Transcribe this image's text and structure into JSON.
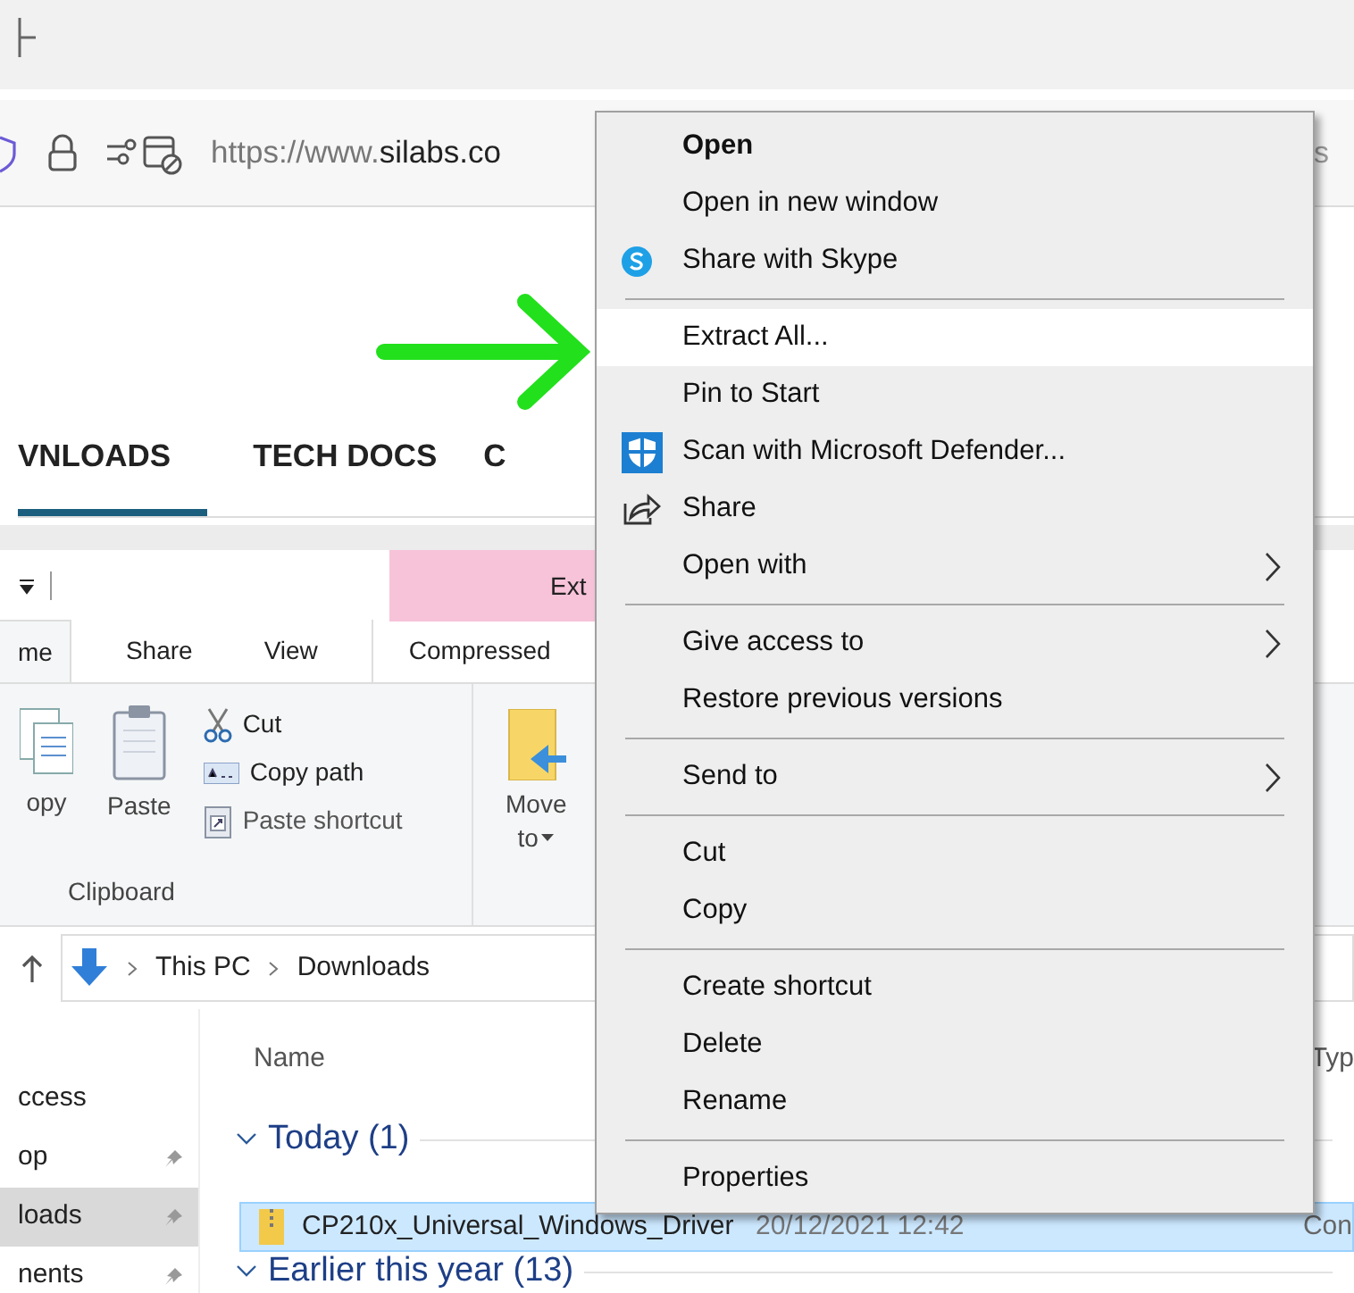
{
  "browser": {
    "address": {
      "url_prefix": "https://www.",
      "url_domain": "silabs.co",
      "url_tail": "s"
    },
    "nav_tabs": [
      {
        "label": "VNLOADS",
        "selected": true
      },
      {
        "label": "TECH DOCS",
        "selected": false
      },
      {
        "label": "C",
        "selected": false
      }
    ]
  },
  "explorer": {
    "contextual_tab": "Ext",
    "ribbon_tabs": [
      {
        "label": "me",
        "selected": true
      },
      {
        "label": "Share",
        "selected": false
      },
      {
        "label": "View",
        "selected": false
      },
      {
        "label": "Compressed",
        "selected": false
      }
    ],
    "clipboard": {
      "copy": "opy",
      "paste": "Paste",
      "cut": "Cut",
      "copy_path": "Copy path",
      "paste_shortcut": "Paste shortcut",
      "group_label": "Clipboard"
    },
    "move_to": {
      "line1": "Move",
      "line2": "to"
    },
    "breadcrumb": [
      "This PC",
      "Downloads"
    ],
    "nav_pane": [
      {
        "label": "ccess",
        "selected": false,
        "pinned": false
      },
      {
        "label": "op",
        "selected": false,
        "pinned": true
      },
      {
        "label": "loads",
        "selected": true,
        "pinned": true
      },
      {
        "label": "nents",
        "selected": false,
        "pinned": true
      }
    ],
    "columns": [
      "Name",
      "Typ"
    ],
    "groups": [
      {
        "label": "Today (1)",
        "expanded": true,
        "files": [
          {
            "name": "CP210x_Universal_Windows_Driver",
            "date": "20/12/2021 12:42",
            "type": "Con",
            "selected": true
          }
        ]
      },
      {
        "label": "Earlier this year (13)",
        "expanded": true
      }
    ]
  },
  "context_menu": [
    {
      "kind": "plain",
      "label": "Open",
      "default": true,
      "selected": false,
      "submenu": false
    },
    {
      "kind": "plain",
      "label": "Open in new window",
      "default": false,
      "selected": false,
      "submenu": false
    },
    {
      "kind": "skype",
      "label": "Share with Skype",
      "default": false,
      "selected": false,
      "submenu": false
    },
    {
      "kind": "separator"
    },
    {
      "kind": "plain",
      "label": "Extract All...",
      "default": false,
      "selected": true,
      "submenu": false
    },
    {
      "kind": "plain",
      "label": "Pin to Start",
      "default": false,
      "selected": false,
      "submenu": false
    },
    {
      "kind": "shield",
      "label": "Scan with Microsoft Defender...",
      "default": false,
      "selected": false,
      "submenu": false
    },
    {
      "kind": "share",
      "label": "Share",
      "default": false,
      "selected": false,
      "submenu": false
    },
    {
      "kind": "plain",
      "label": "Open with",
      "default": false,
      "selected": false,
      "submenu": true
    },
    {
      "kind": "separator"
    },
    {
      "kind": "plain",
      "label": "Give access to",
      "default": false,
      "selected": false,
      "submenu": true
    },
    {
      "kind": "plain",
      "label": "Restore previous versions",
      "default": false,
      "selected": false,
      "submenu": false
    },
    {
      "kind": "separator"
    },
    {
      "kind": "plain",
      "label": "Send to",
      "default": false,
      "selected": false,
      "submenu": true
    },
    {
      "kind": "separator"
    },
    {
      "kind": "plain",
      "label": "Cut",
      "default": false,
      "selected": false,
      "submenu": false
    },
    {
      "kind": "plain",
      "label": "Copy",
      "default": false,
      "selected": false,
      "submenu": false
    },
    {
      "kind": "separator"
    },
    {
      "kind": "plain",
      "label": "Create shortcut",
      "default": false,
      "selected": false,
      "submenu": false
    },
    {
      "kind": "plain",
      "label": "Delete",
      "default": false,
      "selected": false,
      "submenu": false
    },
    {
      "kind": "plain",
      "label": "Rename",
      "default": false,
      "selected": false,
      "submenu": false
    },
    {
      "kind": "separator"
    },
    {
      "kind": "plain",
      "label": "Properties",
      "default": false,
      "selected": false,
      "submenu": false
    }
  ]
}
